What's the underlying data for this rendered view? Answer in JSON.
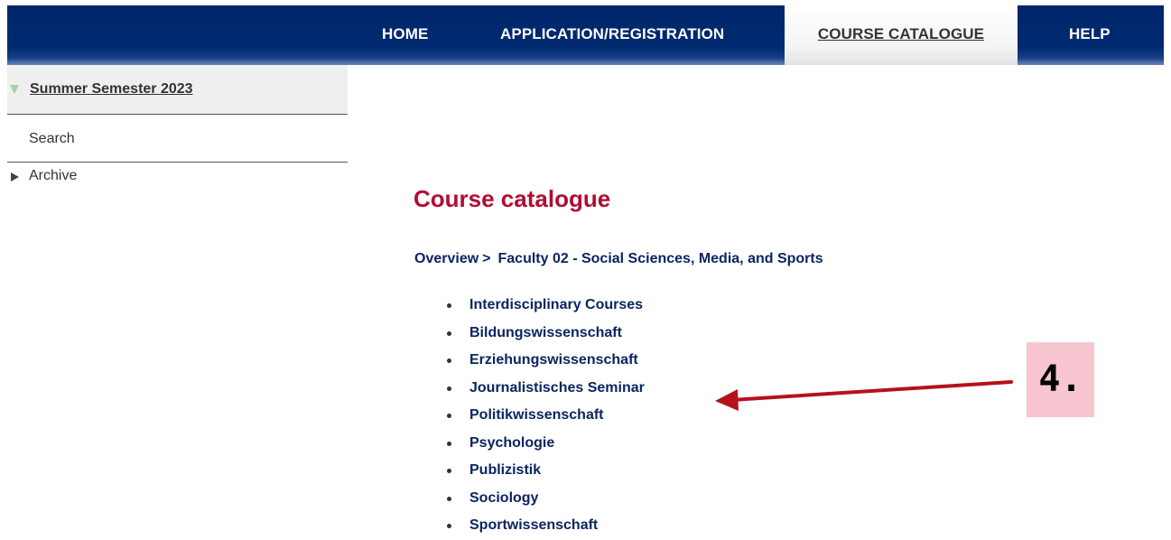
{
  "nav": {
    "items": [
      {
        "label": "HOME"
      },
      {
        "label": "APPLICATION/REGISTRATION"
      },
      {
        "label": "COURSE CATALOGUE",
        "active": true
      },
      {
        "label": "HELP"
      }
    ],
    "background_color": "#00256a",
    "active_color": "#ffffff"
  },
  "sidebar": {
    "semester": "Summer Semester 2023",
    "search": "Search",
    "archive": "Archive"
  },
  "main": {
    "title": "Course catalogue",
    "title_color": "#b00d32",
    "breadcrumb": {
      "overview": "Overview",
      "separator": ">",
      "current": "Faculty 02 - Social Sciences, Media, and Sports"
    },
    "courses": [
      "Interdisciplinary Courses",
      "Bildungswissenschaft",
      "Erziehungswissenschaft",
      "Journalistisches Seminar",
      "Politikwissenschaft",
      "Psychologie",
      "Publizistik",
      "Sociology",
      "Sportwissenschaft"
    ],
    "link_color": "#0b2560"
  },
  "annotation": {
    "label": "4.",
    "arrow_color": "#b5121b",
    "box_color": "#f7c6d1"
  }
}
